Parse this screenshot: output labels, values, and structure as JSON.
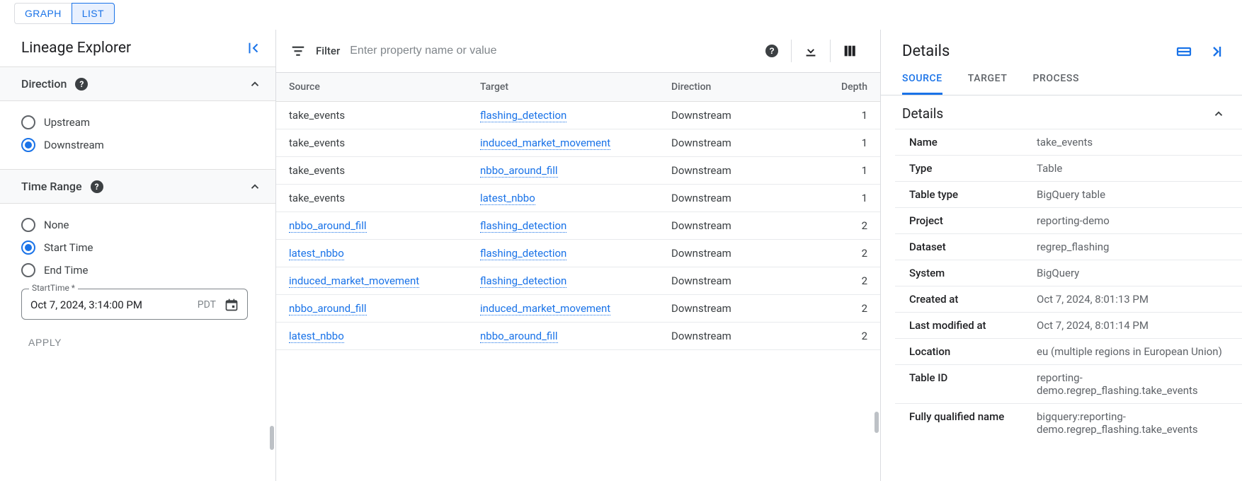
{
  "view_tabs": {
    "graph": "GRAPH",
    "list": "LIST"
  },
  "sidebar": {
    "title": "Lineage Explorer",
    "direction": {
      "label": "Direction",
      "options": {
        "upstream": "Upstream",
        "downstream": "Downstream"
      },
      "selected": "downstream"
    },
    "time_range": {
      "label": "Time Range",
      "options": {
        "none": "None",
        "start": "Start Time",
        "end": "End Time"
      },
      "selected": "start",
      "field_label": "StartTime *",
      "field_value": "Oct 7, 2024, 3:14:00 PM",
      "tz": "PDT"
    },
    "apply": "APPLY"
  },
  "filter": {
    "label": "Filter",
    "placeholder": "Enter property name or value"
  },
  "table": {
    "headers": {
      "source": "Source",
      "target": "Target",
      "direction": "Direction",
      "depth": "Depth"
    },
    "rows": [
      {
        "source": "take_events",
        "source_link": false,
        "target": "flashing_detection",
        "target_link": true,
        "direction": "Downstream",
        "depth": "1"
      },
      {
        "source": "take_events",
        "source_link": false,
        "target": "induced_market_movement",
        "target_link": true,
        "direction": "Downstream",
        "depth": "1"
      },
      {
        "source": "take_events",
        "source_link": false,
        "target": "nbbo_around_fill",
        "target_link": true,
        "direction": "Downstream",
        "depth": "1"
      },
      {
        "source": "take_events",
        "source_link": false,
        "target": "latest_nbbo",
        "target_link": true,
        "direction": "Downstream",
        "depth": "1"
      },
      {
        "source": "nbbo_around_fill",
        "source_link": true,
        "target": "flashing_detection",
        "target_link": true,
        "direction": "Downstream",
        "depth": "2"
      },
      {
        "source": "latest_nbbo",
        "source_link": true,
        "target": "flashing_detection",
        "target_link": true,
        "direction": "Downstream",
        "depth": "2"
      },
      {
        "source": "induced_market_movement",
        "source_link": true,
        "target": "flashing_detection",
        "target_link": true,
        "direction": "Downstream",
        "depth": "2"
      },
      {
        "source": "nbbo_around_fill",
        "source_link": true,
        "target": "induced_market_movement",
        "target_link": true,
        "direction": "Downstream",
        "depth": "2"
      },
      {
        "source": "latest_nbbo",
        "source_link": true,
        "target": "nbbo_around_fill",
        "target_link": true,
        "direction": "Downstream",
        "depth": "2"
      }
    ]
  },
  "details": {
    "title": "Details",
    "tabs": {
      "source": "SOURCE",
      "target": "TARGET",
      "process": "PROCESS"
    },
    "sub_header": "Details",
    "kv": [
      {
        "k": "Name",
        "v": "take_events"
      },
      {
        "k": "Type",
        "v": "Table"
      },
      {
        "k": "Table type",
        "v": "BigQuery table"
      },
      {
        "k": "Project",
        "v": "reporting-demo"
      },
      {
        "k": "Dataset",
        "v": "regrep_flashing"
      },
      {
        "k": "System",
        "v": "BigQuery"
      },
      {
        "k": "Created at",
        "v": "Oct 7, 2024, 8:01:13 PM"
      },
      {
        "k": "Last modified at",
        "v": "Oct 7, 2024, 8:01:14 PM"
      },
      {
        "k": "Location",
        "v": "eu (multiple regions in European Union)"
      },
      {
        "k": "Table ID",
        "v": "reporting-demo.regrep_flashing.take_events"
      },
      {
        "k": "Fully qualified name",
        "v": "bigquery:reporting-demo.regrep_flashing.take_events"
      }
    ]
  }
}
